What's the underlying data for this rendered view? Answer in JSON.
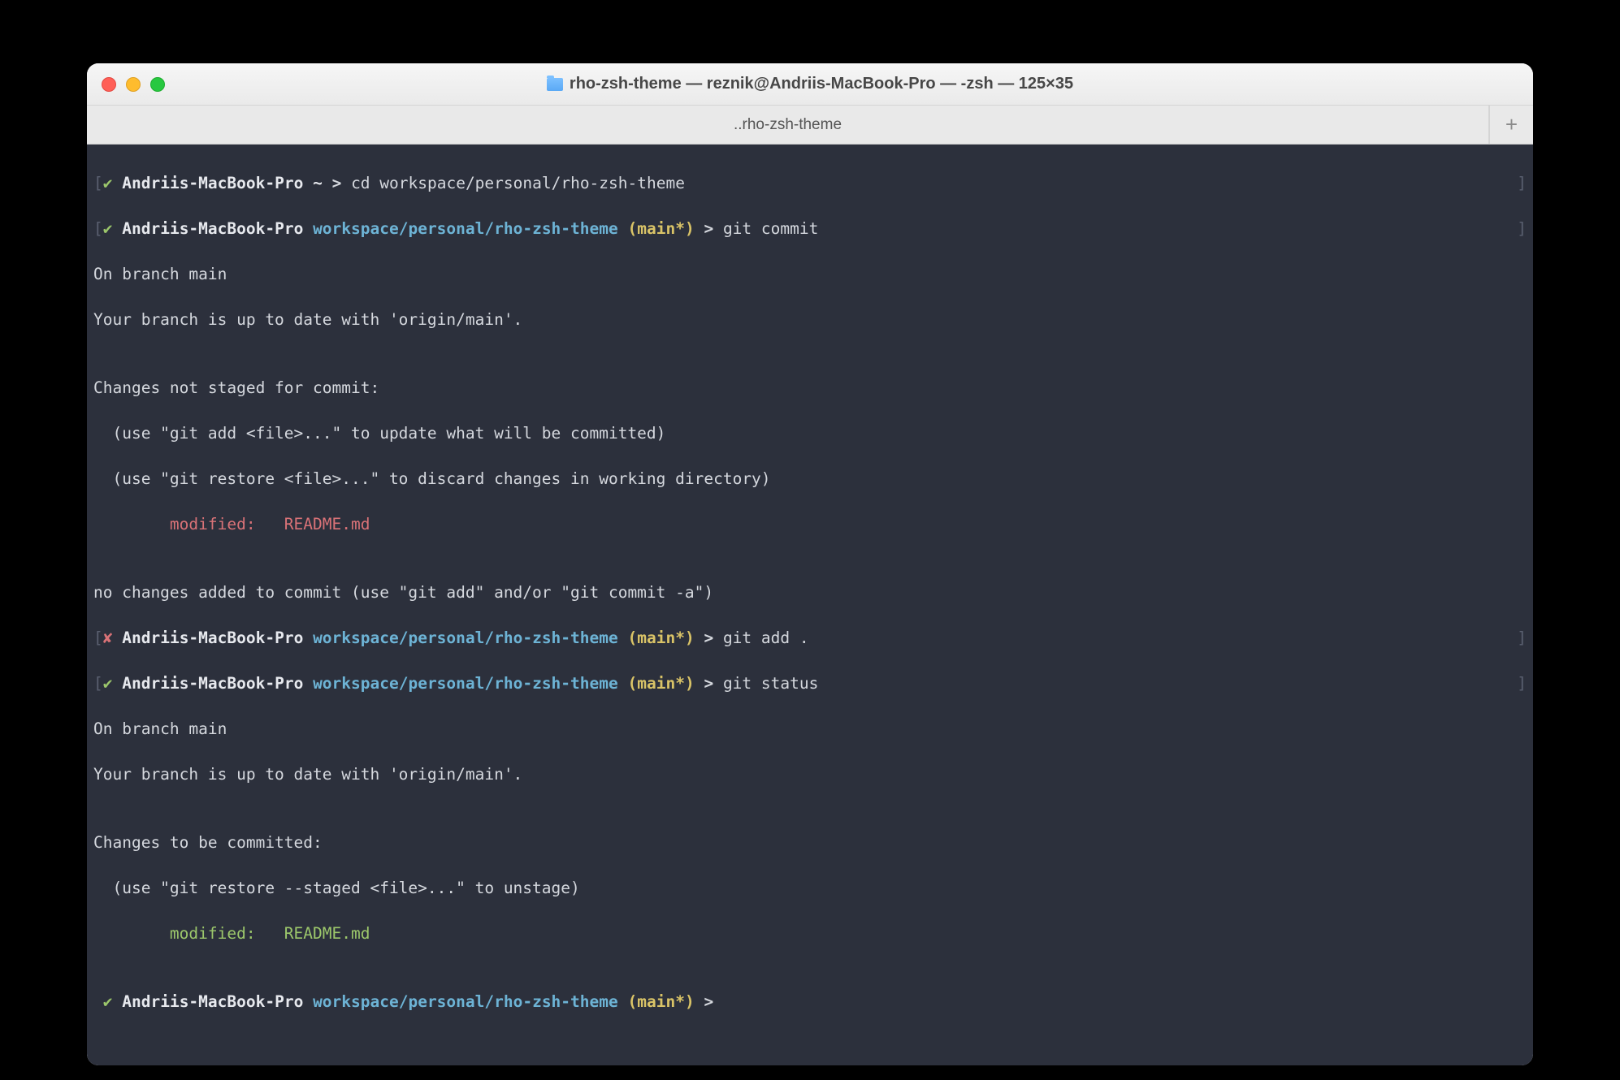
{
  "window": {
    "title": "rho-zsh-theme — reznik@Andriis-MacBook-Pro — -zsh — 125×35"
  },
  "tabbar": {
    "tab_label": "..rho-zsh-theme",
    "new_tab_label": "+"
  },
  "brackets": {
    "open": "[",
    "close": "]"
  },
  "marks": {
    "ok": "✔",
    "fail": "✘"
  },
  "prompt_arrow": ">",
  "prompts": {
    "p1": {
      "host": "Andriis-MacBook-Pro",
      "home": "~",
      "cmd": "cd workspace/personal/rho-zsh-theme"
    },
    "p2": {
      "host": "Andriis-MacBook-Pro",
      "path": "workspace/personal/rho-zsh-theme",
      "branch": "(main*)",
      "cmd": "git commit"
    },
    "p3": {
      "host": "Andriis-MacBook-Pro",
      "path": "workspace/personal/rho-zsh-theme",
      "branch": "(main*)",
      "cmd": "git add ."
    },
    "p4": {
      "host": "Andriis-MacBook-Pro",
      "path": "workspace/personal/rho-zsh-theme",
      "branch": "(main*)",
      "cmd": "git status"
    },
    "p5": {
      "host": "Andriis-MacBook-Pro",
      "path": "workspace/personal/rho-zsh-theme",
      "branch": "(main*)"
    }
  },
  "output": {
    "l1": "On branch main",
    "l2": "Your branch is up to date with 'origin/main'.",
    "blank": "",
    "l3": "Changes not staged for commit:",
    "l4": "  (use \"git add <file>...\" to update what will be committed)",
    "l5": "  (use \"git restore <file>...\" to discard changes in working directory)",
    "l6": "        modified:   README.md",
    "l7": "no changes added to commit (use \"git add\" and/or \"git commit -a\")",
    "l8": "On branch main",
    "l9": "Your branch is up to date with 'origin/main'.",
    "l10": "Changes to be committed:",
    "l11": "  (use \"git restore --staged <file>...\" to unstage)",
    "l12": "        modified:   README.md"
  }
}
